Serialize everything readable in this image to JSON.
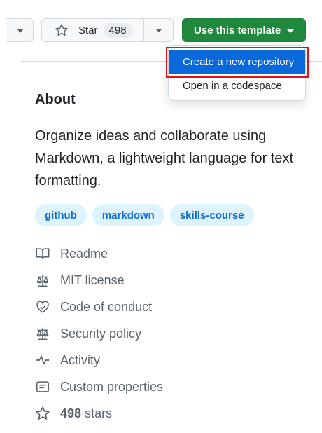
{
  "header": {
    "star_label": "Star",
    "star_count": "498",
    "template_label": "Use this template"
  },
  "menu": {
    "create_repo": "Create a new repository",
    "open_codespace": "Open in a codespace"
  },
  "about": {
    "title": "About",
    "description": "Organize ideas and collaborate using Markdown, a lightweight language for text formatting."
  },
  "topics": [
    "github",
    "markdown",
    "skills-course"
  ],
  "links": [
    {
      "icon": "book-icon",
      "label": "Readme"
    },
    {
      "icon": "law-icon",
      "label": "MIT license"
    },
    {
      "icon": "code-of-conduct-icon",
      "label": "Code of conduct"
    },
    {
      "icon": "law-icon",
      "label": "Security policy"
    },
    {
      "icon": "pulse-icon",
      "label": "Activity"
    },
    {
      "icon": "note-icon",
      "label": "Custom properties"
    }
  ],
  "stars": {
    "count": "498",
    "label": "stars"
  },
  "colors": {
    "primary_green": "#1f883d",
    "accent_blue": "#0969da",
    "topic_bg": "#ddf4ff",
    "highlight_red": "#e3111b"
  }
}
